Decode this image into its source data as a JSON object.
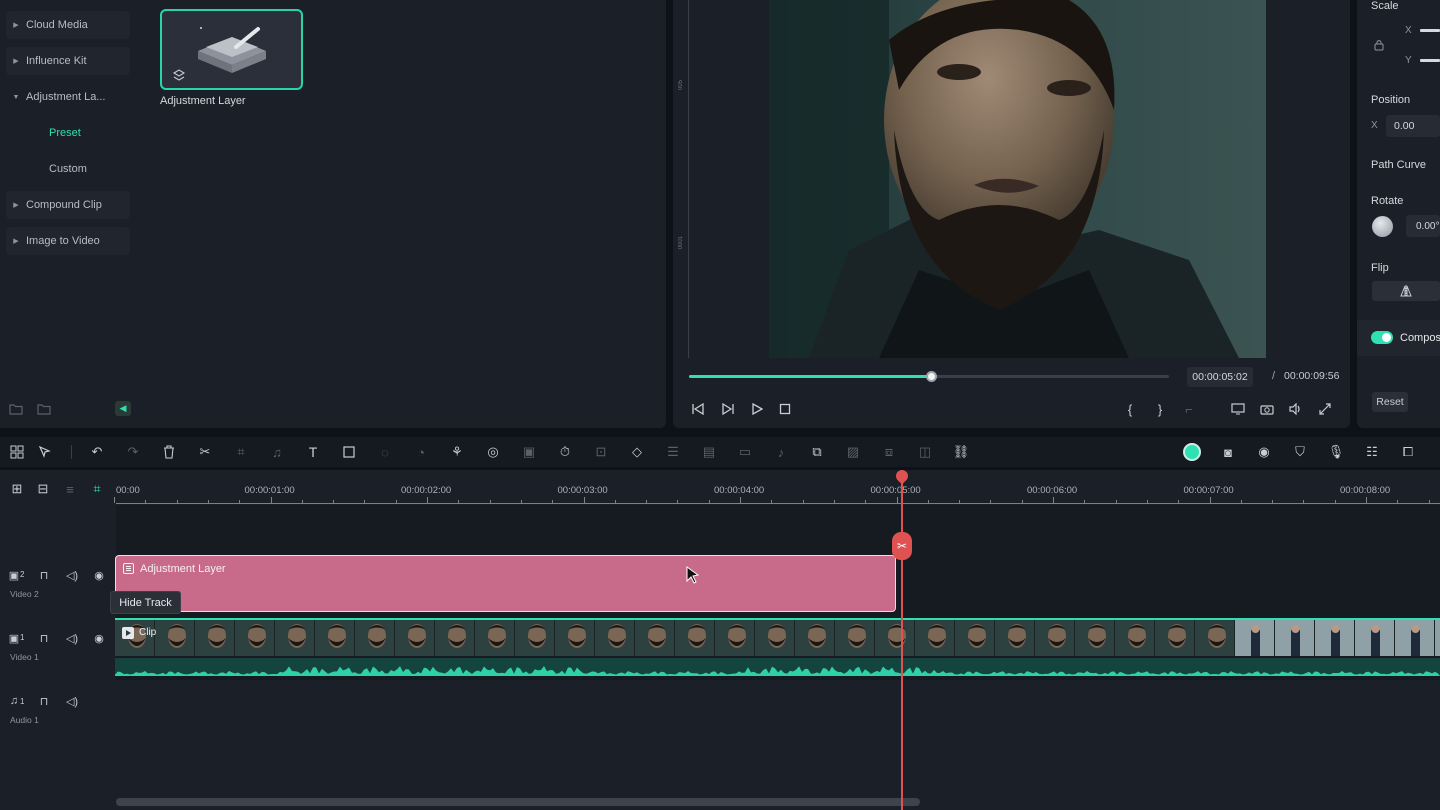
{
  "library": {
    "nav": [
      {
        "label": "Cloud Media"
      },
      {
        "label": "Influence Kit"
      },
      {
        "label": "Adjustment La..."
      },
      {
        "label": "Compound Clip"
      },
      {
        "label": "Image to Video"
      }
    ],
    "subnav": [
      {
        "label": "Preset",
        "active": true
      },
      {
        "label": "Custom",
        "active": false
      }
    ],
    "asset": {
      "label": "Adjustment Layer"
    }
  },
  "player": {
    "current_time": "00:00:05:02",
    "separator": "/",
    "total_time": "00:00:09:56",
    "progress": 0.505,
    "ruler_marks": [
      "005",
      "0001"
    ]
  },
  "properties": {
    "scale_label": "Scale",
    "scale_x": "X",
    "scale_y": "Y",
    "position_label": "Position",
    "position_x_label": "X",
    "position_x_value": "0.00",
    "path_curve_label": "Path Curve",
    "rotate_label": "Rotate",
    "rotate_value": "0.00°",
    "flip_label": "Flip",
    "compositing_label": "Compos",
    "reset_label": "Reset"
  },
  "timeline": {
    "ruler_labels": [
      "00:00",
      "00:00:01:00",
      "00:00:02:00",
      "00:00:03:00",
      "00:00:04:00",
      "00:00:05:00",
      "00:00:06:00",
      "00:00:07:00",
      "00:00:08:00"
    ],
    "tracks": [
      {
        "index": "2",
        "name": "Video 2"
      },
      {
        "index": "1",
        "name": "Video 1"
      },
      {
        "index": "1",
        "name": "Audio 1"
      }
    ],
    "adjustment_clip_label": "Adjustment Layer",
    "video_clip_label": "Clip",
    "tooltip": "Hide Track"
  },
  "colors": {
    "accent": "#2ee0b4",
    "playhead": "#e05252",
    "adjustment_clip": "#c86a8a"
  }
}
